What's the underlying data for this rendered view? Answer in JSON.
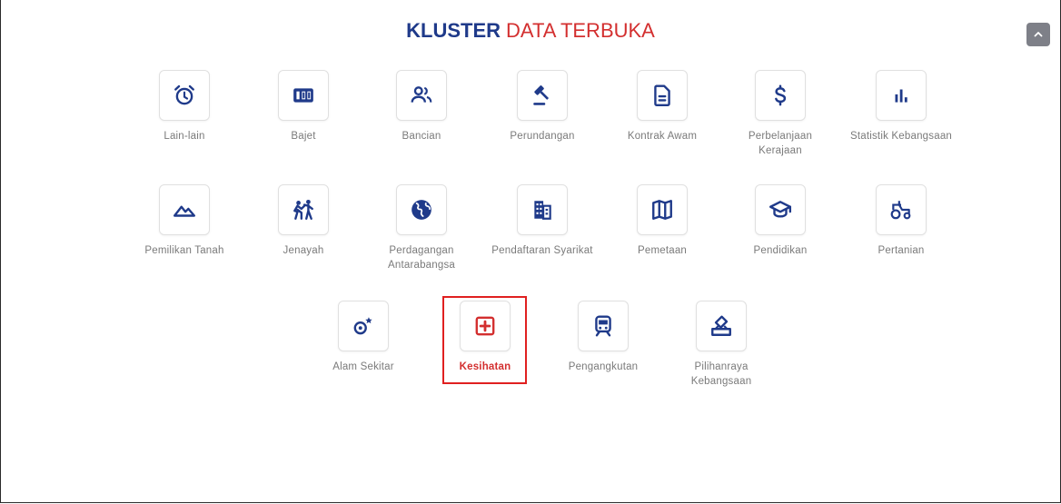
{
  "title": {
    "part1": "KLUSTER",
    "part2": "DATA TERBUKA"
  },
  "colors": {
    "primary": "#1f3a8a",
    "accent": "#d32f2f"
  },
  "tiles": [
    {
      "label": "Lain-lain",
      "icon": "alarm-clock-icon"
    },
    {
      "label": "Bajet",
      "icon": "budget-counter-icon"
    },
    {
      "label": "Bancian",
      "icon": "people-icon"
    },
    {
      "label": "Perundangan",
      "icon": "gavel-icon"
    },
    {
      "label": "Kontrak Awam",
      "icon": "document-icon"
    },
    {
      "label": "Perbelanjaan Kerajaan",
      "icon": "dollar-icon"
    },
    {
      "label": "Statistik Kebangsaan",
      "icon": "bar-chart-icon"
    },
    {
      "label": "Pemilikan Tanah",
      "icon": "landscape-icon"
    },
    {
      "label": "Jenayah",
      "icon": "fight-icon"
    },
    {
      "label": "Perdagangan Antarabangsa",
      "icon": "globe-icon"
    },
    {
      "label": "Pendaftaran Syarikat",
      "icon": "building-icon"
    },
    {
      "label": "Pemetaan",
      "icon": "map-icon"
    },
    {
      "label": "Pendidikan",
      "icon": "graduation-cap-icon"
    },
    {
      "label": "Pertanian",
      "icon": "tractor-icon"
    },
    {
      "label": "Alam Sekitar",
      "icon": "environment-icon"
    },
    {
      "label": "Kesihatan",
      "icon": "health-plus-icon"
    },
    {
      "label": "Pengangkutan",
      "icon": "train-icon"
    },
    {
      "label": "Pilihanraya Kebangsaan",
      "icon": "ballot-box-icon"
    }
  ]
}
